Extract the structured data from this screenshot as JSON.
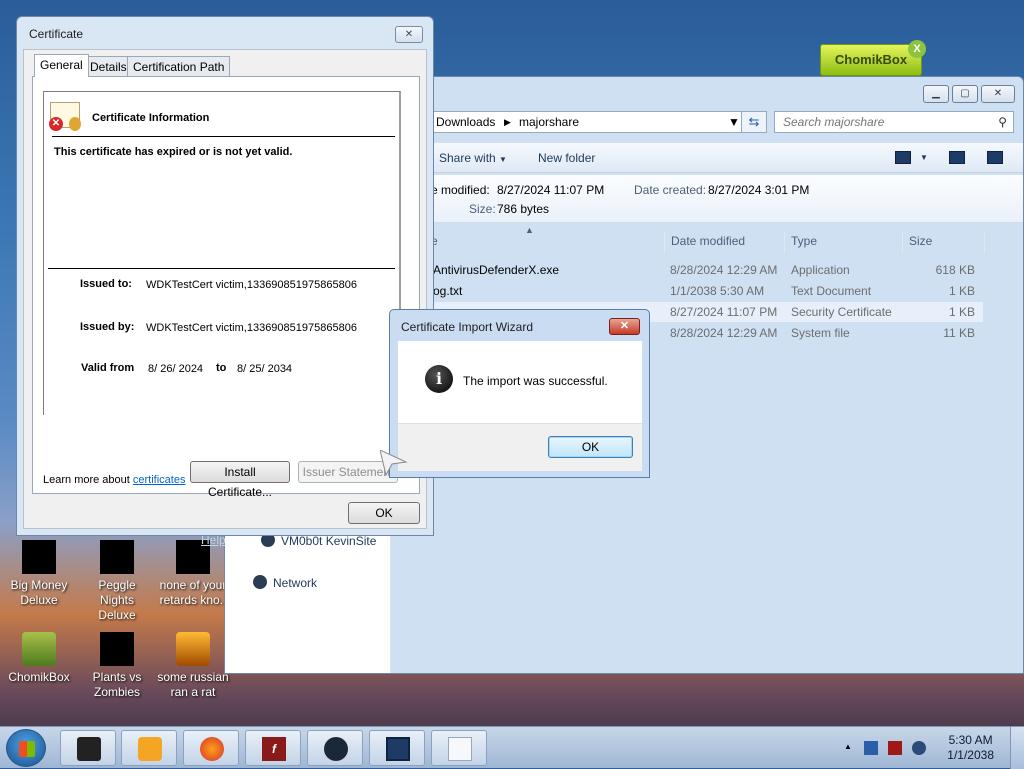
{
  "desktop": {
    "icons": [
      {
        "line1": "Big Money",
        "line2": "Deluxe"
      },
      {
        "line1": "Peggle Nights",
        "line2": "Deluxe"
      },
      {
        "line1": "none of your",
        "line2": "retards kno.."
      },
      {
        "line1": "ChomikBox",
        "line2": ""
      },
      {
        "line1": "Plants vs",
        "line2": "Zombies"
      },
      {
        "line1": "some russian",
        "line2": "ran a rat"
      }
    ],
    "chomikbox_badge": "ChomikBox",
    "chomikbox_close": "X"
  },
  "explorer": {
    "breadcrumb": [
      "Downloads",
      "majorshare"
    ],
    "search_placeholder": "Search majorshare",
    "toolbar": {
      "share_with": "Share with",
      "new_folder": "New folder"
    },
    "details": {
      "modified_label": "e modified:",
      "modified_value": "8/27/2024 11:07 PM",
      "created_label": "Date created:",
      "created_value": "8/27/2024 3:01 PM",
      "size_label": "Size:",
      "size_value": "786 bytes"
    },
    "columns": {
      "name": "e",
      "date": "Date modified",
      "type": "Type",
      "size": "Size"
    },
    "rows": [
      {
        "name": "AntivirusDefenderX.exe",
        "date": "8/28/2024 12:29 AM",
        "type": "Application",
        "size": "618 KB"
      },
      {
        "name": "og.txt",
        "date": "1/1/2038 5:30 AM",
        "type": "Text Document",
        "size": "1 KB"
      },
      {
        "name": "",
        "date": "8/27/2024 11:07 PM",
        "type": "Security Certificate",
        "size": "1 KB"
      },
      {
        "name": "",
        "date": "8/28/2024 12:29 AM",
        "type": "System file",
        "size": "11 KB"
      }
    ],
    "nav": {
      "help_fragment": "Help",
      "site": "VM0b0t KevinSite",
      "network": "Network"
    }
  },
  "certificate": {
    "title": "Certificate",
    "close": "✕",
    "tabs": [
      "General",
      "Details",
      "Certification Path"
    ],
    "heading": "Certificate Information",
    "warning": "This certificate has expired or is not yet valid.",
    "issued_to_label": "Issued to:",
    "issued_to_value": "WDKTestCert victim,133690851975865806",
    "issued_by_label": "Issued by:",
    "issued_by_value": "WDKTestCert victim,133690851975865806",
    "valid_from_label": "Valid from",
    "valid_from_value": "8/ 26/ 2024",
    "valid_to_word": "to",
    "valid_to_value": "8/ 25/ 2034",
    "install_button": "Install Certificate...",
    "issuer_button": "Issuer Statement",
    "learn_more": "Learn more about",
    "learn_more_link": "certificates",
    "ok_button": "OK"
  },
  "wizard": {
    "title": "Certificate Import Wizard",
    "close": "✕",
    "message": "The import was successful.",
    "ok_button": "OK"
  },
  "taskbar": {
    "clock_time": "5:30 AM",
    "clock_date": "1/1/2038",
    "tray_arrow": "▲"
  }
}
